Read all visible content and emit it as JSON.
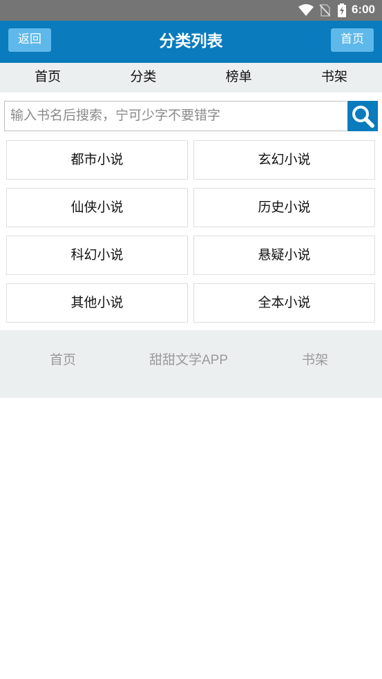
{
  "status_bar": {
    "time": "6:00",
    "icons": [
      "wifi-icon",
      "no-sim-icon",
      "battery-charging-icon"
    ]
  },
  "header": {
    "back_label": "返回",
    "title": "分类列表",
    "home_label": "首页"
  },
  "nav": {
    "items": [
      {
        "label": "首页"
      },
      {
        "label": "分类"
      },
      {
        "label": "榜单"
      },
      {
        "label": "书架"
      }
    ]
  },
  "search": {
    "placeholder": "输入书名后搜索，宁可少字不要错字",
    "value": "",
    "icon": "search-icon"
  },
  "categories": [
    {
      "label": "都市小说"
    },
    {
      "label": "玄幻小说"
    },
    {
      "label": "仙侠小说"
    },
    {
      "label": "历史小说"
    },
    {
      "label": "科幻小说"
    },
    {
      "label": "悬疑小说"
    },
    {
      "label": "其他小说"
    },
    {
      "label": "全本小说"
    }
  ],
  "footer": {
    "home": "首页",
    "app": "甜甜文学APP",
    "shelf": "书架"
  },
  "colors": {
    "primary": "#0a7bbd",
    "button": "#5eb8ea",
    "nav_bg": "#eceff0",
    "status_bg": "#757575"
  }
}
